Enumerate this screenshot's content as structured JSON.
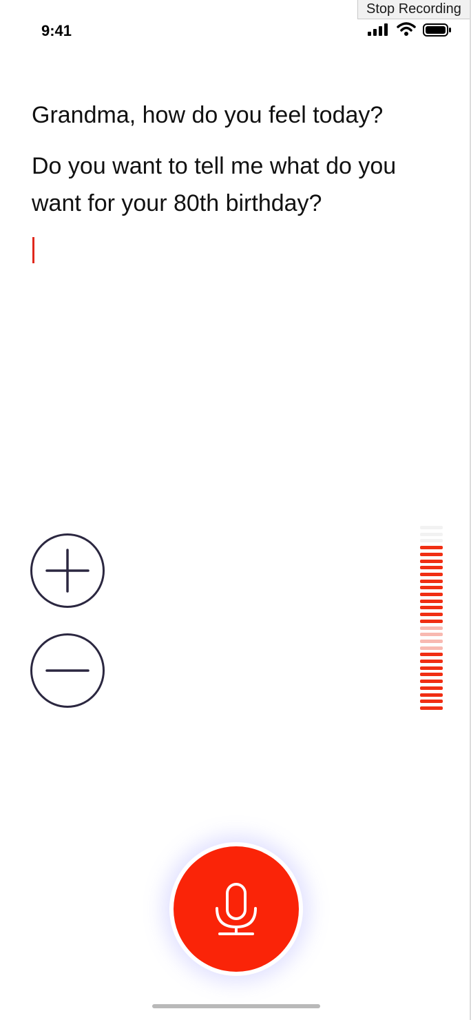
{
  "overlay": {
    "stop_recording_label": "Stop Recording"
  },
  "status_bar": {
    "time": "9:41",
    "icons": [
      "signal-icon",
      "wifi-icon",
      "battery-icon"
    ]
  },
  "transcript": {
    "lines": [
      "Grandma, how do you feel today?",
      "Do you want to tell me what do you want for your 80th birthday?"
    ]
  },
  "controls": {
    "zoom_in_icon": "plus-icon",
    "zoom_out_icon": "minus-icon",
    "record_icon": "microphone-icon"
  },
  "level_meter": {
    "total_segments": 28,
    "segments": [
      "empty",
      "empty",
      "empty",
      "full",
      "full",
      "full",
      "full",
      "full",
      "full",
      "full",
      "full",
      "full",
      "full",
      "full",
      "full",
      "faint",
      "faint",
      "faint",
      "faint",
      "full",
      "full",
      "full",
      "full",
      "full",
      "full",
      "full",
      "full",
      "full"
    ]
  },
  "colors": {
    "accent": "#fa2408",
    "caret": "#e0281c",
    "meter_full": "#f02e13",
    "meter_faint": "#f8b9b1",
    "meter_empty": "#f2f2f2",
    "button_stroke": "#2b2740"
  }
}
